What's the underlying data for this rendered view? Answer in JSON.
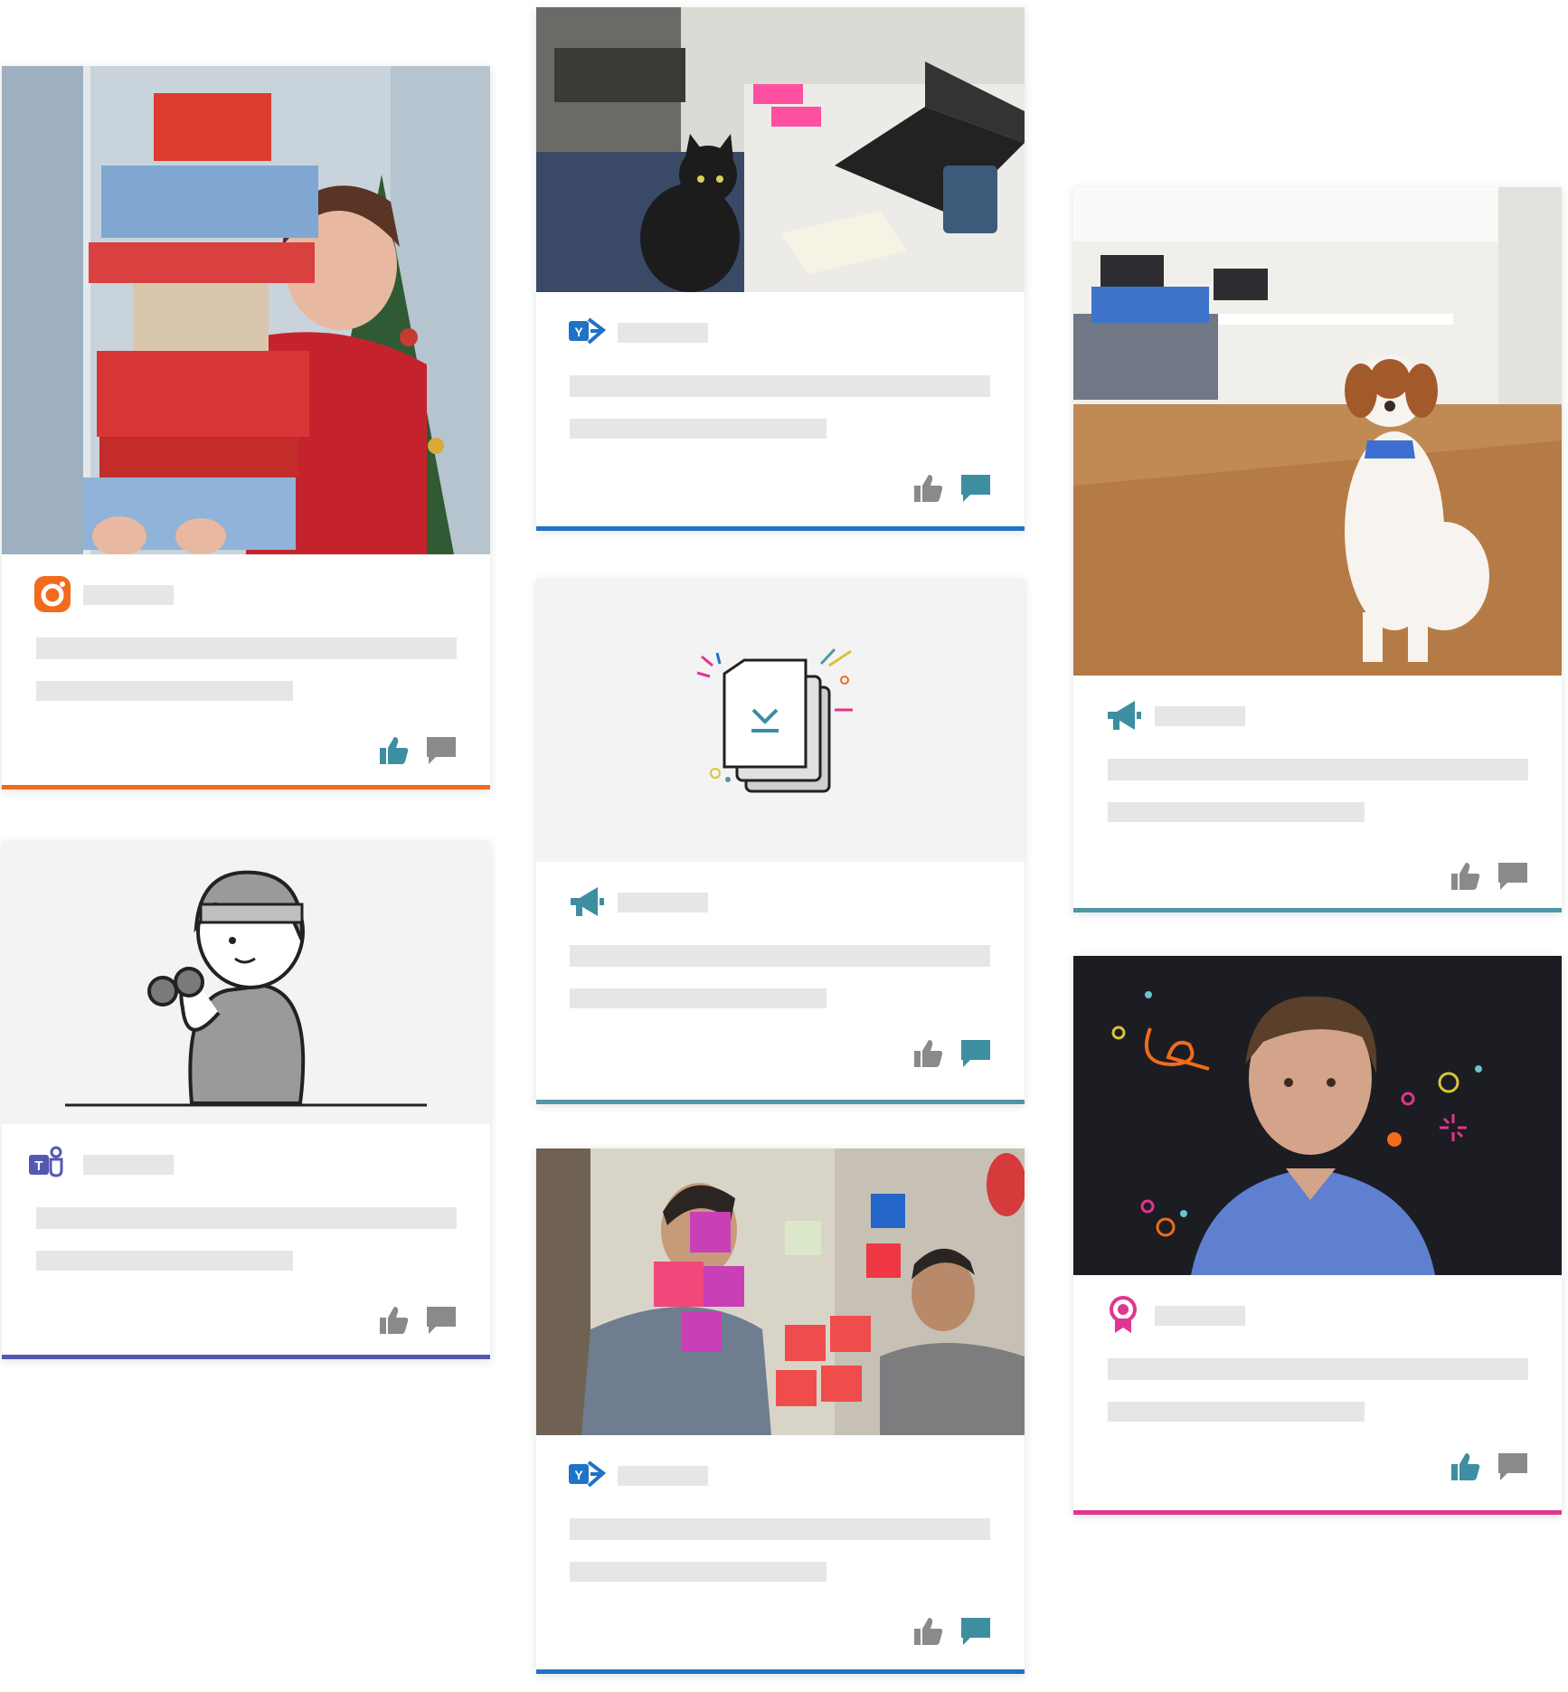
{
  "colors": {
    "placeholder": "#e6e6e6",
    "action_gray": "#8a8a8a",
    "accent_orange": "#f26b1d",
    "accent_blue": "#1f73c6",
    "accent_teal": "#4e97a8",
    "accent_indigo": "#5558af",
    "accent_pink": "#e1358f",
    "icon_teal": "#3d8ea0"
  },
  "cards": [
    {
      "id": "gifts-photo",
      "source_icon": "instagram-icon",
      "accent": "#f26b1d",
      "media": "photo-woman-with-gift-boxes"
    },
    {
      "id": "desk-cat-photo",
      "source_icon": "yammer-icon",
      "accent": "#1f73c6",
      "media": "photo-cat-at-desk"
    },
    {
      "id": "download-illustration",
      "source_icon": "megaphone-icon",
      "accent": "#4e97a8",
      "media": "illustration-document-download"
    },
    {
      "id": "sticky-notes-photo",
      "source_icon": "yammer-icon",
      "accent": "#1f73c6",
      "media": "photo-team-sticky-notes"
    },
    {
      "id": "exercise-illustration",
      "source_icon": "teams-icon",
      "accent": "#5558af",
      "media": "illustration-person-with-dumbbell"
    },
    {
      "id": "office-dog-photo",
      "source_icon": "megaphone-icon",
      "accent": "#4e97a8",
      "media": "photo-dog-in-office"
    },
    {
      "id": "portrait-photo",
      "source_icon": "award-ribbon-icon",
      "accent": "#e1358f",
      "media": "photo-man-portrait-confetti"
    }
  ],
  "action_icons": [
    "thumbs-up-icon",
    "comment-icon"
  ]
}
